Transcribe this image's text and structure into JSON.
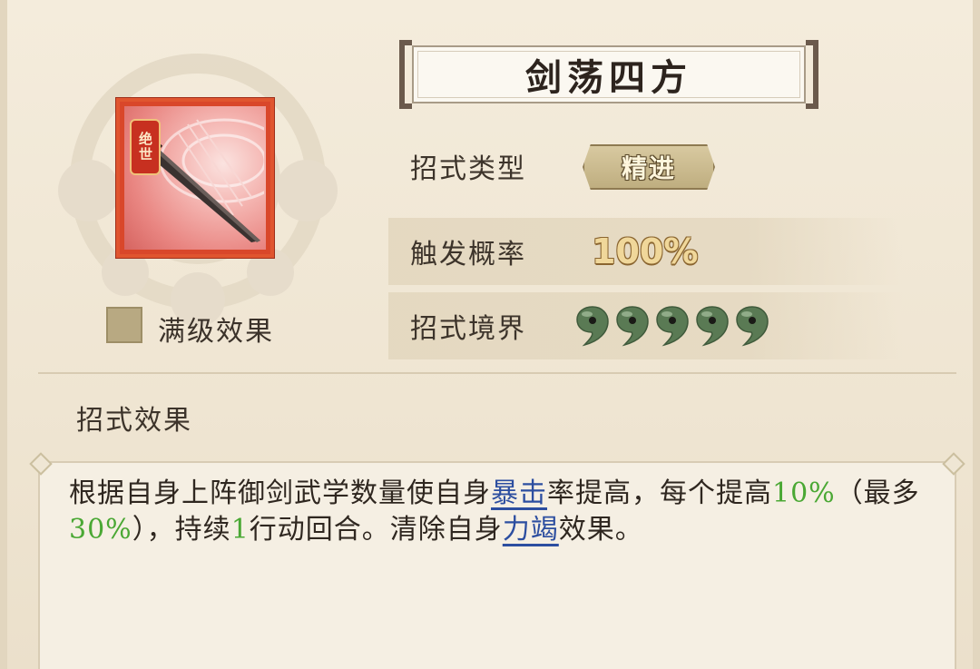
{
  "skill": {
    "name": "剑荡四方",
    "icon_name": "sword-skill-icon",
    "rarity_tag": "绝世"
  },
  "max_level_toggle": {
    "label": "满级效果",
    "checked": false
  },
  "attributes": {
    "type_label": "招式类型",
    "type_value": "精进",
    "trigger_label": "触发概率",
    "trigger_value": "100%",
    "realm_label": "招式境界",
    "realm_level": 5,
    "realm_max": 5
  },
  "effect": {
    "section_title": "招式效果",
    "segments": [
      {
        "text": "根据自身上阵御剑武学数量使自身",
        "style": "plain"
      },
      {
        "text": "暴击",
        "style": "keyword"
      },
      {
        "text": "率提高，每个提高",
        "style": "plain"
      },
      {
        "text": "10%",
        "style": "number"
      },
      {
        "text": "（最多",
        "style": "plain"
      },
      {
        "text": "30%",
        "style": "number"
      },
      {
        "text": "），持续",
        "style": "plain"
      },
      {
        "text": "1",
        "style": "number"
      },
      {
        "text": "行动回合。清除自身",
        "style": "plain"
      },
      {
        "text": "力竭",
        "style": "keyword"
      },
      {
        "text": "效果。",
        "style": "plain"
      }
    ]
  },
  "colors": {
    "keyword": "#2c4ea0",
    "number": "#4aa834",
    "icon_frame": "#e0552f",
    "realm_jade": "#5a7a54"
  }
}
